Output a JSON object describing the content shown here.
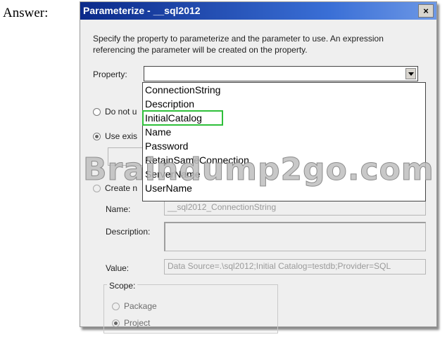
{
  "answer_label": "Answer:",
  "dialog": {
    "title": "Parameterize - __sql2012",
    "close_glyph": "×",
    "instructions": "Specify the property to parameterize and the parameter to use. An expression referencing the parameter will be created on the property.",
    "property_label": "Property:",
    "property_value": "",
    "property_options": [
      "ConnectionString",
      "Description",
      "InitialCatalog",
      "Name",
      "Password",
      "RetainSameConnection",
      "ServerName",
      "UserName"
    ],
    "highlighted_option": "InitialCatalog",
    "radio_do_not_use_label": "Do not u",
    "radio_use_existing_label": "Use exis",
    "radio_create_label": "Create n",
    "name_label": "Name:",
    "name_value": "__sql2012_ConnectionString",
    "description_label": "Description:",
    "description_value": "",
    "value_label": "Value:",
    "value_value": "Data Source=.\\sql2012;Initial Catalog=testdb;Provider=SQL",
    "scope_label": "Scope:",
    "scope_package_label": "Package",
    "scope_project_label": "Project"
  },
  "watermark": "Braindump2go.com",
  "colors": {
    "title_bar": "#0b2a8a",
    "highlight_outline": "#2fbf3a",
    "dialog_bg": "#efefef"
  }
}
